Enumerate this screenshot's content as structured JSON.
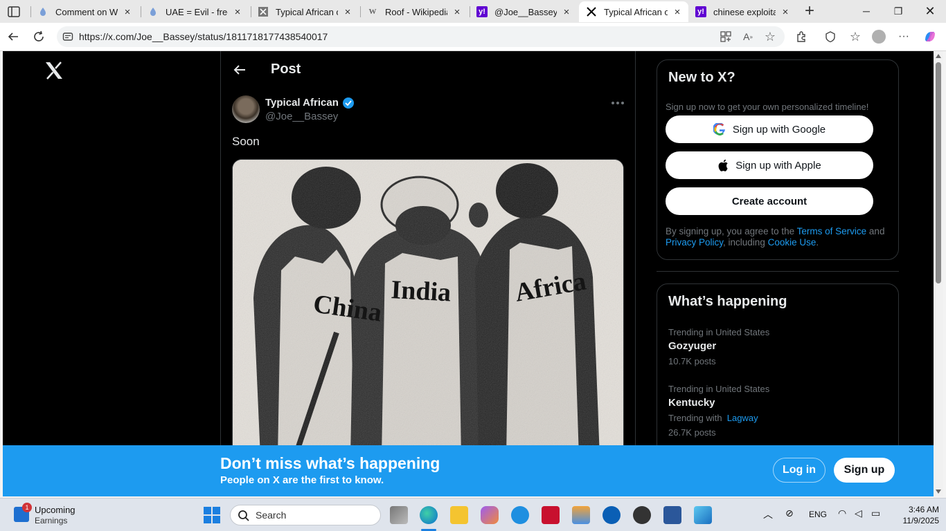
{
  "browser": {
    "tabs": [
      {
        "title": "Comment on Why",
        "favicon": "doc-icon"
      },
      {
        "title": "UAE = Evil - freeth",
        "favicon": "doc-icon"
      },
      {
        "title": "Typical African on",
        "favicon": "x-icon"
      },
      {
        "title": "Roof - Wikipedia",
        "favicon": "wikipedia-icon"
      },
      {
        "title": "@Joe__Bassey, chi",
        "favicon": "yahoo-icon"
      },
      {
        "title": "Typical African on",
        "favicon": "x-icon",
        "active": true
      },
      {
        "title": "chinese exploitatio",
        "favicon": "yahoo-icon"
      }
    ],
    "url": "https://x.com/Joe__Bassey/status/1811718177438540017"
  },
  "x_page": {
    "header_title": "Post",
    "author": {
      "name": "Typical African",
      "handle": "@Joe__Bassey",
      "verified": true
    },
    "post_text": "Soon",
    "image_labels": [
      "China",
      "India",
      "Africa"
    ],
    "signup_card": {
      "title": "New to X?",
      "subtitle": "Sign up now to get your own personalized timeline!",
      "google_button": "Sign up with Google",
      "apple_button": "Sign up with Apple",
      "create_button": "Create account",
      "legal_prefix": "By signing up, you agree to the ",
      "terms_link": "Terms of Service",
      "and": " and ",
      "privacy_link": "Privacy Policy",
      "including": ", including ",
      "cookie_link": "Cookie Use",
      "period": "."
    },
    "trends_card": {
      "title": "What’s happening",
      "trends": [
        {
          "context": "Trending in United States",
          "name": "Gozyuger",
          "count": "10.7K posts"
        },
        {
          "context": "Trending in United States",
          "name": "Kentucky",
          "with_prefix": "Trending with",
          "with_link": "Lagway",
          "count": "26.7K posts"
        }
      ]
    },
    "banner": {
      "headline": "Don’t miss what’s happening",
      "subline": "People on X are the first to know.",
      "login": "Log in",
      "signup": "Sign up"
    }
  },
  "taskbar": {
    "weather_title": "Upcoming",
    "weather_sub": "Earnings",
    "notification_count": "1",
    "search_placeholder": "Search",
    "language": "ENG",
    "time": "3:46 AM",
    "date": "11/9/2025"
  },
  "colors": {
    "x_blue": "#1d9bf0",
    "page_bg": "#000000",
    "taskbar_bg": "#dfe4ec"
  }
}
